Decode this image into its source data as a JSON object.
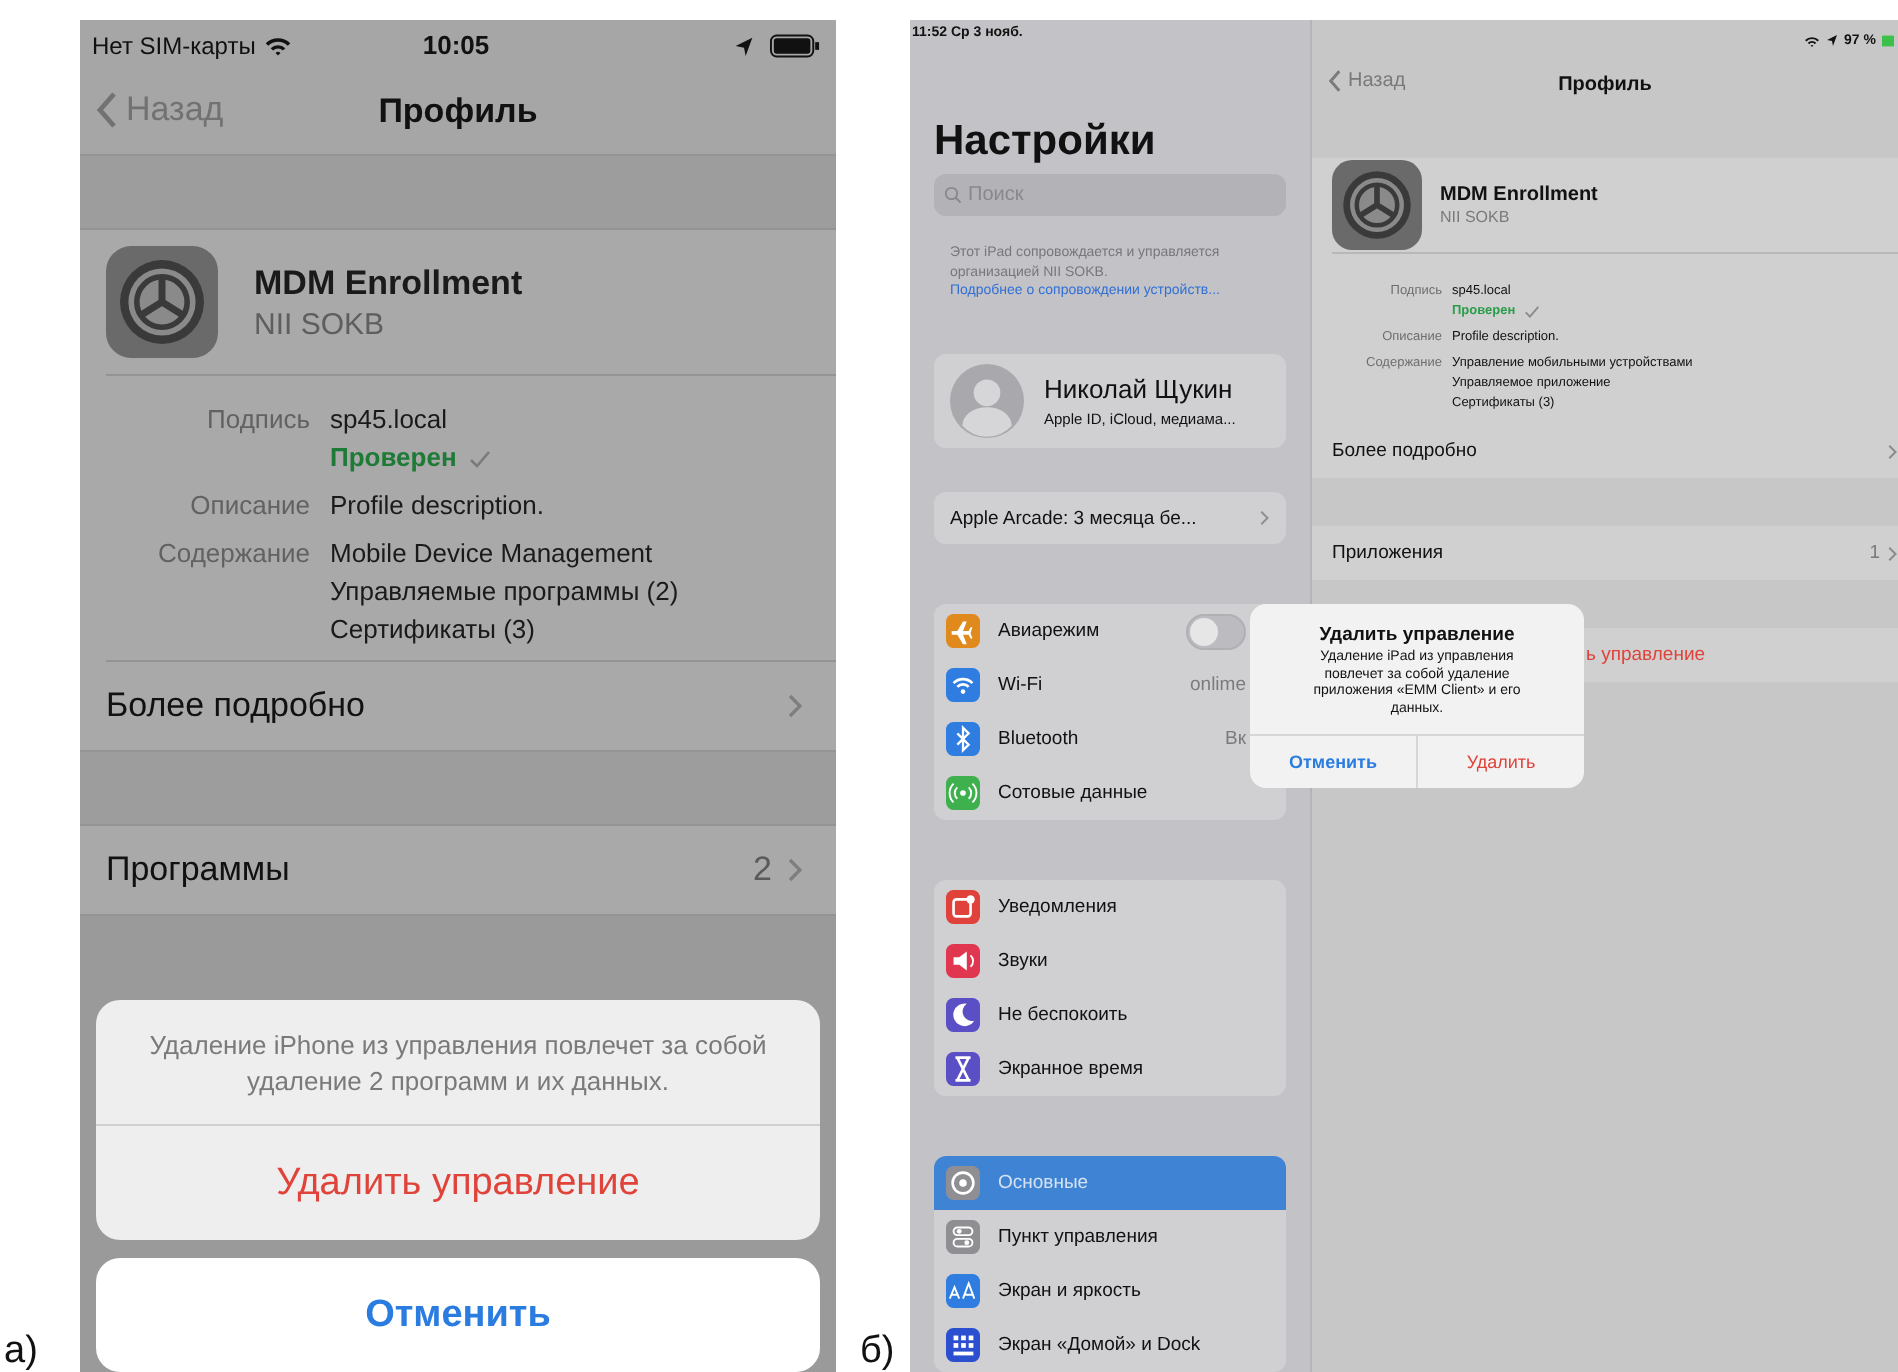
{
  "iphone": {
    "label": "а)",
    "status_bar": {
      "carrier": "Нет SIM-карты",
      "time": "10:05"
    },
    "nav": {
      "back": "Назад",
      "title": "Профиль"
    },
    "profile": {
      "name": "MDM Enrollment",
      "org": "NII SOKB",
      "fields": [
        {
          "label": "Подпись",
          "values": [
            {
              "text": "sp45.local",
              "kind": "plain"
            },
            {
              "text": "Проверен",
              "kind": "verified"
            }
          ]
        },
        {
          "label": "Описание",
          "values": [
            {
              "text": "Profile description.",
              "kind": "plain"
            }
          ]
        },
        {
          "label": "Содержание",
          "values": [
            {
              "text": "Mobile Device Management",
              "kind": "plain"
            },
            {
              "text": "Управляемые программы (2)",
              "kind": "plain"
            },
            {
              "text": "Сертификаты (3)",
              "kind": "plain"
            }
          ]
        }
      ]
    },
    "more": "Более подробно",
    "programs": {
      "label": "Программы",
      "count": "2"
    },
    "action_sheet": {
      "message": "Удаление iPhone из управления повлечет за собой удаление 2 программ и их данных.",
      "destructive": "Удалить управление",
      "cancel": "Отменить"
    }
  },
  "ipad": {
    "label": "б)",
    "status_bar": {
      "time": "11:52  Ср 3 нояб.",
      "battery": "97 %"
    },
    "sidebar": {
      "title": "Настройки",
      "search": {
        "placeholder": "Поиск"
      },
      "note": "Этот iPad сопровождается и управляется организацией NII SOKB.",
      "note_link": "Подробнее о сопровождении устройств...",
      "account": {
        "name": "Николай Щукин",
        "subtitle": "Apple ID, iCloud, медиама..."
      },
      "promo": "Apple Arcade: 3 месяца бе...",
      "groups": [
        {
          "items": [
            {
              "label": "Авиарежим",
              "color": "#e08a1e",
              "kind": "toggle",
              "on": false,
              "selected": false
            },
            {
              "label": "Wi-Fi",
              "color": "#2f7de0",
              "kind": "value",
              "value": "onlime",
              "selected": false
            },
            {
              "label": "Bluetooth",
              "color": "#2f7de0",
              "kind": "value",
              "value": "Вк",
              "selected": false
            },
            {
              "label": "Сотовые данные",
              "color": "#3fb04e",
              "kind": "plain",
              "selected": false
            }
          ]
        },
        {
          "items": [
            {
              "label": "Уведомления",
              "color": "#e0413a",
              "kind": "plain",
              "selected": false
            },
            {
              "label": "Звуки",
              "color": "#e0364f",
              "kind": "plain",
              "selected": false
            },
            {
              "label": "Не беспокоить",
              "color": "#5a4fc4",
              "kind": "plain",
              "selected": false
            },
            {
              "label": "Экранное время",
              "color": "#5a4fc4",
              "kind": "plain",
              "selected": false
            }
          ]
        },
        {
          "items": [
            {
              "label": "Основные",
              "color": "#8e8e93",
              "kind": "plain",
              "selected": true
            },
            {
              "label": "Пункт управления",
              "color": "#8e8e93",
              "kind": "plain",
              "selected": false
            },
            {
              "label": "Экран и яркость",
              "color": "#2f7de0",
              "kind": "plain",
              "selected": false
            },
            {
              "label": "Экран «Домой» и Dock",
              "color": "#2c4fd0",
              "kind": "plain",
              "selected": false
            }
          ]
        }
      ]
    },
    "detail": {
      "nav": {
        "back": "Назад",
        "title": "Профиль"
      },
      "profile": {
        "name": "MDM Enrollment",
        "org": "NII SOKB",
        "fields": [
          {
            "label": "Подпись",
            "values": [
              {
                "text": "sp45.local",
                "kind": "plain"
              },
              {
                "text": "Проверен",
                "kind": "verified"
              }
            ]
          },
          {
            "label": "Описание",
            "values": [
              {
                "text": "Profile description.",
                "kind": "plain"
              }
            ]
          },
          {
            "label": "Содержание",
            "values": [
              {
                "text": "Управление мобильными устройствами",
                "kind": "plain"
              },
              {
                "text": "Управляемое приложение",
                "kind": "plain"
              },
              {
                "text": "Сертификаты (3)",
                "kind": "plain"
              }
            ]
          }
        ]
      },
      "more": "Более подробно",
      "apps": {
        "label": "Приложения",
        "count": "1"
      },
      "remove": "ь управление"
    },
    "alert": {
      "title": "Удалить управление",
      "message": "Удаление iPad из управления повлечет за собой удаление приложения «EMM Client» и его данных.",
      "cancel": "Отменить",
      "confirm": "Удалить"
    }
  }
}
